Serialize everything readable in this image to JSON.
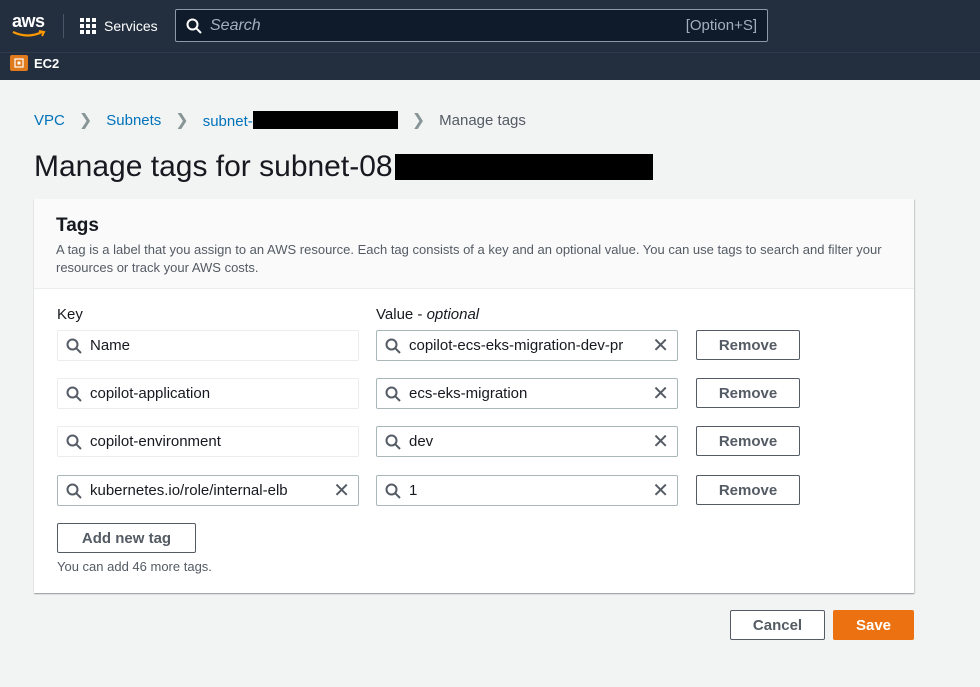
{
  "nav": {
    "logo_text": "aws",
    "services_label": "Services",
    "search_placeholder": "Search",
    "search_shortcut": "[Option+S]",
    "service_name": "EC2"
  },
  "breadcrumb": {
    "items": [
      "VPC",
      "Subnets",
      "subnet-"
    ],
    "current": "Manage tags"
  },
  "page": {
    "title": "Manage tags for subnet-08"
  },
  "tags_panel": {
    "heading": "Tags",
    "description": "A tag is a label that you assign to an AWS resource. Each tag consists of a key and an optional value. You can use tags to search and filter your resources or track your AWS costs.",
    "key_label": "Key",
    "value_label": "Value - ",
    "value_label_optional": "optional",
    "rows": [
      {
        "key": "Name",
        "value": "copilot-ecs-eks-migration-dev-pr",
        "remove": "Remove"
      },
      {
        "key": "copilot-application",
        "value": "ecs-eks-migration",
        "remove": "Remove"
      },
      {
        "key": "copilot-environment",
        "value": "dev",
        "remove": "Remove"
      },
      {
        "key": "kubernetes.io/role/internal-elb",
        "value": "1",
        "remove": "Remove"
      }
    ],
    "add_button": "Add new tag",
    "hint": "You can add 46 more tags."
  },
  "footer": {
    "cancel": "Cancel",
    "save": "Save"
  },
  "colors": {
    "nav_bg": "#232f3e",
    "link": "#0073bb",
    "primary": "#ec7211"
  }
}
